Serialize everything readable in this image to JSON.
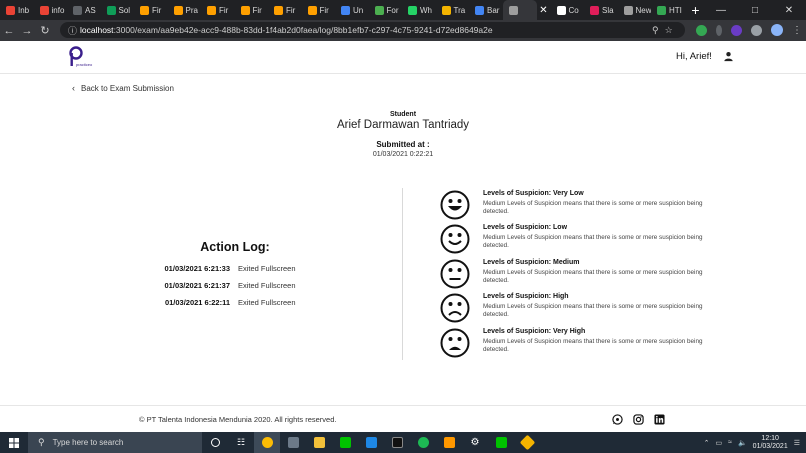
{
  "browser": {
    "tabs": [
      {
        "label": "Inb",
        "color": "#ea4335"
      },
      {
        "label": "info",
        "color": "#ea4335"
      },
      {
        "label": "AS",
        "color": "#5f6368"
      },
      {
        "label": "Sol",
        "color": "#0f9d58"
      },
      {
        "label": "Fir",
        "color": "#ffa000"
      },
      {
        "label": "Pra",
        "color": "#ffa000"
      },
      {
        "label": "Fir",
        "color": "#ffa000"
      },
      {
        "label": "Fir",
        "color": "#ffa000"
      },
      {
        "label": "Fir",
        "color": "#ffa000"
      },
      {
        "label": "Fir",
        "color": "#ffa000"
      },
      {
        "label": "Un",
        "color": "#4285f4"
      },
      {
        "label": "For",
        "color": "#4caf50"
      },
      {
        "label": "Wh",
        "color": "#25d366"
      },
      {
        "label": "Tra",
        "color": "#f4b400"
      },
      {
        "label": "Bar",
        "color": "#4285f4"
      },
      {
        "label": "",
        "color": "#9e9e9e",
        "active": true
      },
      {
        "label": "Co",
        "color": "#ffffff"
      },
      {
        "label": "Sla",
        "color": "#e01e5a"
      },
      {
        "label": "New Ta",
        "color": "#9e9e9e"
      },
      {
        "label": "HTI",
        "color": "#34a853"
      }
    ],
    "url_host": "localhost",
    "url_path": ":3000/exam/aa9eb42e-acc9-488b-83dd-1f4ab2d0faea/log/8bb1efb7-c297-4c75-9241-d72ed8649a2e"
  },
  "header": {
    "greeting": "Hi, Arief!"
  },
  "nav": {
    "back_label": "Back to Exam Submission"
  },
  "submission": {
    "student_label": "Student",
    "student_name": "Arief Darmawan Tantriady",
    "submitted_label": "Submitted at :",
    "submitted_value": "01/03/2021 0:22:21"
  },
  "action_log": {
    "title": "Action Log:",
    "entries": [
      {
        "time": "01/03/2021 6:21:33",
        "event": "Exited Fullscreen"
      },
      {
        "time": "01/03/2021 6:21:37",
        "event": "Exited Fullscreen"
      },
      {
        "time": "01/03/2021 6:22:11",
        "event": "Exited Fullscreen"
      }
    ]
  },
  "legend": [
    {
      "title": "Levels of Suspicion: Very Low",
      "desc": "Medium Levels of Suspicion means that there is some or mere suspicion being detected.",
      "icon": "very-happy-face"
    },
    {
      "title": "Levels of Suspicion: Low",
      "desc": "Medium Levels of Suspicion means that there is some or mere suspicion being detected.",
      "icon": "smiling-face"
    },
    {
      "title": "Levels of Suspicion: Medium",
      "desc": "Medium Levels of Suspicion means that there is some or mere suspicion being detected.",
      "icon": "neutral-face"
    },
    {
      "title": "Levels of Suspicion: High",
      "desc": "Medium Levels of Suspicion means that there is some or mere suspicion being detected.",
      "icon": "sad-face"
    },
    {
      "title": "Levels of Suspicion: Very High",
      "desc": "Medium Levels of Suspicion means that there is some or mere suspicion being detected.",
      "icon": "very-sad-face"
    }
  ],
  "footer": {
    "copyright": "© PT Talenta Indonesia Mendunia 2020. All rights reserved."
  },
  "taskbar": {
    "search_placeholder": "Type here to search",
    "time": "12:10",
    "date": "01/03/2021"
  },
  "colors": {
    "brand": "#3b1f8c",
    "chrome_dark": "#202124",
    "taskbar": "#1f2a36"
  }
}
